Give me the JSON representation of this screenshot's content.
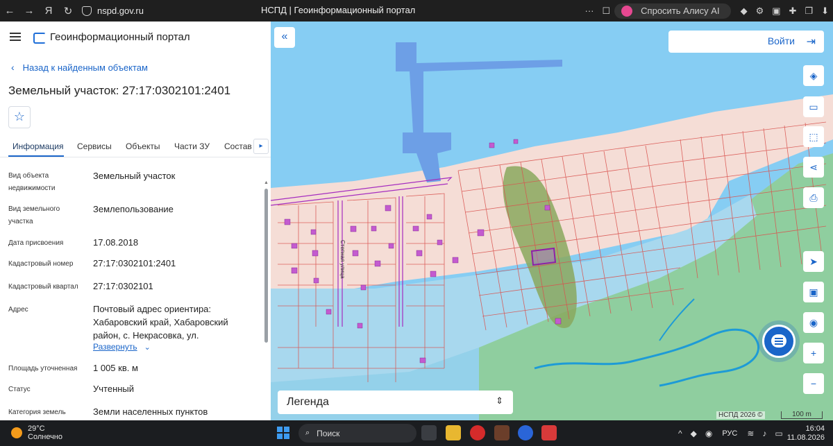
{
  "browser": {
    "url": "nspd.gov.ru",
    "tab_title": "НСПД | Геоинформационный портал",
    "alice_label": "Спросить Алису AI",
    "menu_dots": "···"
  },
  "panel": {
    "portal_name": "Геоинформационный портал",
    "back_label": "Назад к найденным объектам",
    "title": "Земельный участок: 27:17:0302101:2401",
    "tabs": [
      "Информация",
      "Сервисы",
      "Объекты",
      "Части ЗУ",
      "Состав"
    ],
    "active_tab": "Информация",
    "fields": [
      {
        "label": "Вид объекта недвижимости",
        "value": "Земельный участок"
      },
      {
        "label": "Вид земельного участка",
        "value": "Землепользование"
      },
      {
        "label": "Дата присвоения",
        "value": "17.08.2018"
      },
      {
        "label": "Кадастровый номер",
        "value": "27:17:0302101:2401"
      },
      {
        "label": "Кадастровый квартал",
        "value": "27:17:0302101"
      },
      {
        "label": "Адрес",
        "value": "Почтовый адрес ориентира: Хабаровский край, Хабаровский район, с. Некрасовка, ул."
      },
      {
        "label": "Площадь уточненная",
        "value": "1 005 кв. м"
      },
      {
        "label": "Статус",
        "value": "Учтенный"
      },
      {
        "label": "Категория земель",
        "value": "Земли населенных пунктов"
      }
    ],
    "expand_label": "Развернуть"
  },
  "map": {
    "login_label": "Войти",
    "legend_label": "Легенда",
    "street_label": "Степная улица",
    "copyright": "НСПД 2026 ©",
    "scale_label": "100 m",
    "colors": {
      "water": "#86cdf3",
      "residential": "#f5ddd6",
      "forest": "#8fce9a",
      "parcel_line": "#d9534f",
      "selected_parcel": "#8e1fa8",
      "accent": "#1a65c9"
    }
  },
  "taskbar": {
    "temperature": "29°C",
    "weather": "Солнечно",
    "search_label": "Поиск",
    "language": "РУС",
    "time": "16:04",
    "date": "11.08.2026"
  }
}
